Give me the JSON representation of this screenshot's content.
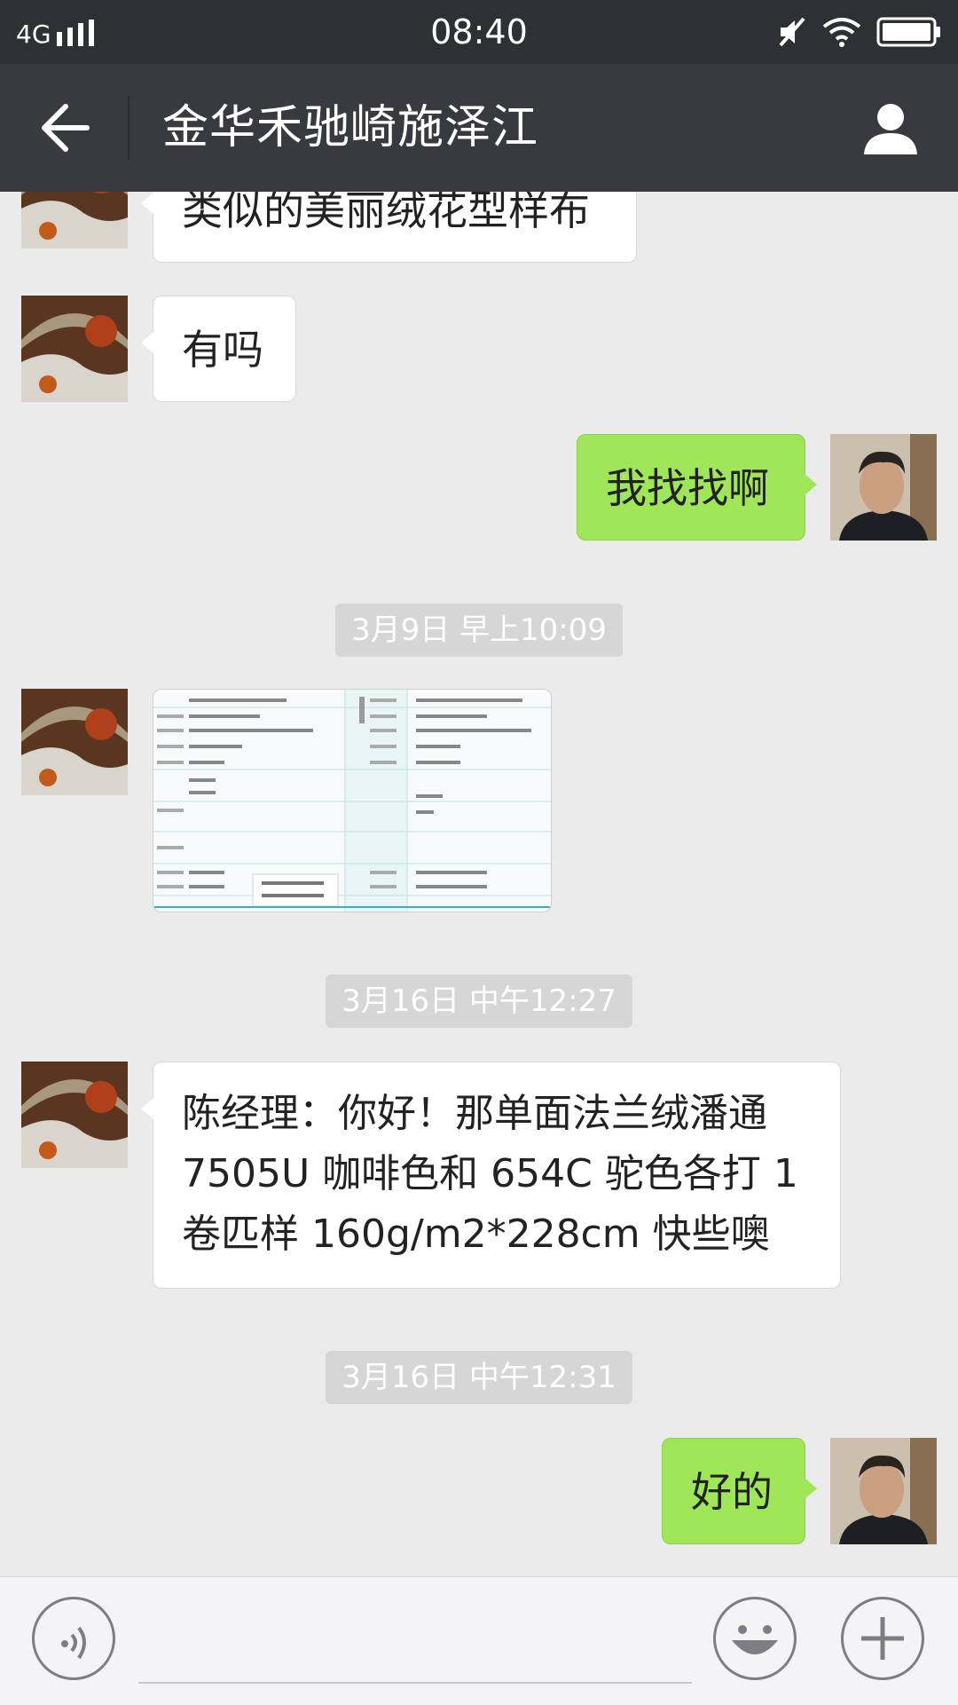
{
  "status_bar": {
    "network": "4G",
    "time": "08:40"
  },
  "title_bar": {
    "title": "金华禾驰崎施泽江"
  },
  "messages": [
    {
      "side": "in",
      "text": "类似的美丽绒花型样布"
    },
    {
      "side": "in",
      "text": "有吗"
    },
    {
      "side": "out",
      "text": "我找找啊"
    },
    {
      "type": "time",
      "text": "3月9日 早上10:09"
    },
    {
      "side": "in",
      "type": "image"
    },
    {
      "type": "time",
      "text": "3月16日 中午12:27"
    },
    {
      "side": "in",
      "lines": [
        "陈经理：你好！那单面法兰绒潘通",
        "7505U 咖啡色和 654C 驼色各打 1",
        "卷匹样 160g/m2*228cm 快些噢"
      ]
    },
    {
      "type": "time",
      "text": "3月16日 中午12:31"
    },
    {
      "side": "out",
      "text": "好的"
    }
  ],
  "colors": {
    "status_bar": "#2e3133",
    "title_bar": "#393a3f",
    "chat_bg": "#ebebeb",
    "bubble_out": "#9fe658",
    "bubble_in": "#ffffff",
    "timestamp_bg": "#d6d6d6"
  },
  "icons": {
    "back": "arrow-left-icon",
    "profile": "person-icon",
    "voice": "voice-icon",
    "emoji": "smiley-icon",
    "more": "plus-icon"
  }
}
